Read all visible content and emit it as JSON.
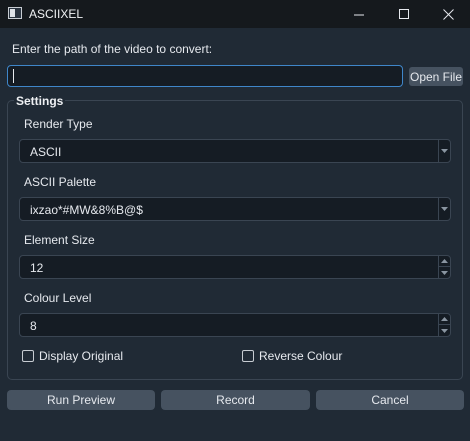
{
  "window": {
    "title": "ASCIIXEL"
  },
  "path": {
    "label": "Enter the path of the video to convert:",
    "value": "",
    "open_file_label": "Open File"
  },
  "settings": {
    "title": "Settings",
    "render_type": {
      "label": "Render Type",
      "value": "ASCII"
    },
    "ascii_palette": {
      "label": "ASCII Palette",
      "value": "ixzao*#MW&8%B@$"
    },
    "element_size": {
      "label": "Element Size",
      "value": "12"
    },
    "colour_level": {
      "label": "Colour Level",
      "value": "8"
    },
    "display_original": {
      "label": "Display Original",
      "checked": false
    },
    "reverse_colour": {
      "label": "Reverse Colour",
      "checked": false
    }
  },
  "actions": {
    "run_preview": "Run Preview",
    "record": "Record",
    "cancel": "Cancel"
  }
}
